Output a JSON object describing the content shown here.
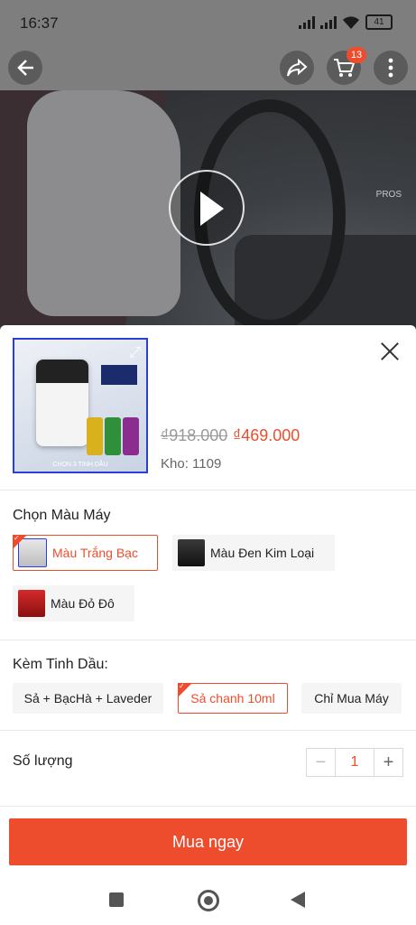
{
  "status": {
    "time": "16:37",
    "battery": "41"
  },
  "header": {
    "cart_count": "13"
  },
  "video": {
    "watermark": "PROS"
  },
  "product": {
    "thumb_caption": "CHỌN 3 TINH DẦU",
    "old_price": "₫918.000",
    "new_price": "₫469.000",
    "stock": "Kho: 1109"
  },
  "color_section": {
    "title": "Chọn Màu Máy",
    "options": [
      "Màu Trắng Bạc",
      "Màu Đen Kim Loại",
      "Màu Đỏ Đô"
    ],
    "selected": "Màu Trắng Bạc"
  },
  "oil_section": {
    "title": "Kèm Tinh Dầu:",
    "options": [
      "Sả + BạcHà + Laveder",
      "Sả chanh 10ml",
      "Chỉ Mua Máy"
    ],
    "selected": "Sả chanh 10ml"
  },
  "quantity": {
    "label": "Số lượng",
    "minus": "−",
    "value": "1",
    "plus": "+"
  },
  "buy_button": {
    "label": "Mua ngay"
  },
  "colors": {
    "accent": "#ee4d2d"
  }
}
